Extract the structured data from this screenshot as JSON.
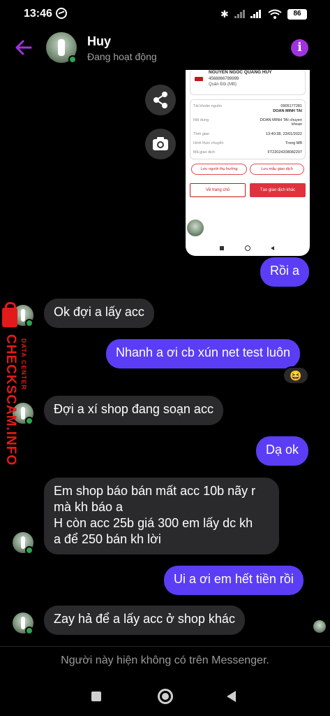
{
  "status_bar": {
    "time": "13:46",
    "battery": "86",
    "icons": [
      "messenger-icon",
      "bluetooth-icon",
      "signal-icon",
      "signal-icon",
      "wifi-icon",
      "battery-icon"
    ]
  },
  "header": {
    "contact_name": "Huy",
    "contact_status": "Đang hoạt động",
    "info_label": "i",
    "accent_color": "#a033e0"
  },
  "shared_image": {
    "recipient_name": "NGUYEN NGOC QUANG HUY",
    "recipient_account": "4568866789999",
    "recipient_bank": "Quân Đội (MB)",
    "rows": [
      {
        "label": "Tài khoản nguồn",
        "value": "0905177281"
      },
      {
        "label": "",
        "value": "DOAN MINH TAI"
      },
      {
        "label": "Nội dung",
        "value": "DOAN MINH TAI chuyen khoan"
      },
      {
        "label": "Thời gian",
        "value": "13:40:38, 23/01/2022"
      },
      {
        "label": "Hình thức chuyển",
        "value": "Trong MB"
      },
      {
        "label": "Mã giao dịch",
        "value": "FT22024208082207"
      }
    ],
    "save_recipient": "Lưu người thụ hưởng",
    "save_template": "Lưu mẫu giao dịch",
    "home_button": "Về trang chủ",
    "new_transaction_button": "Tạo giao dịch khác"
  },
  "messages": [
    {
      "direction": "out",
      "text": "Rồi a"
    },
    {
      "direction": "in",
      "text": "Ok đợi a lấy acc"
    },
    {
      "direction": "out",
      "text": "Nhanh a ơi cb xún net test luôn",
      "reaction": "😆"
    },
    {
      "direction": "in",
      "text": "Đợi a xí shop đang soạn acc"
    },
    {
      "direction": "out",
      "text": "Dạ ok"
    },
    {
      "direction": "in",
      "text": "Em shop báo bán mất acc 10b nãy r\nmà kh báo a\nH còn acc 25b giá 300 em lấy dc kh\na để 250 bán kh lời"
    },
    {
      "direction": "out",
      "text": "Ui a ơi em hết tiền rồi"
    },
    {
      "direction": "in",
      "text": "Zay hả để a lấy acc ở shop khác"
    }
  ],
  "watermark": {
    "main": "CHECKSCAM.INFO",
    "sub": "DATA CENTER"
  },
  "footer": {
    "notice": "Người này hiện không có trên Messenger."
  },
  "colors": {
    "outgoing_bubble": "#5b3df5",
    "incoming_bubble": "#2a2a2c",
    "online": "#31a24c",
    "watermark": "#e31a1a"
  }
}
